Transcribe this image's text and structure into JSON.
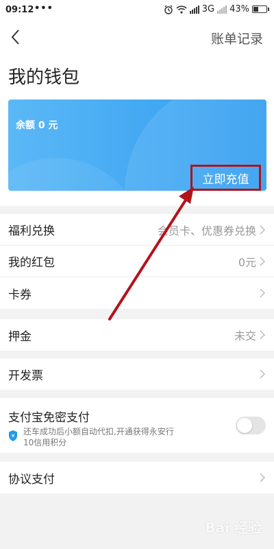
{
  "status_bar": {
    "time": "09:12",
    "dots": "•••",
    "network": "3G",
    "battery_text": "43%",
    "battery_level": 0.43
  },
  "nav": {
    "bill_link": "账单记录"
  },
  "page": {
    "title": "我的钱包"
  },
  "wallet_card": {
    "balance": "余额 0 元",
    "recharge_label": "立即充值"
  },
  "menu": {
    "welfare": {
      "label": "福利兑换",
      "value": "会员卡、优惠券兑换"
    },
    "red_packet": {
      "label": "我的红包",
      "value": "0元"
    },
    "coupons": {
      "label": "卡券"
    },
    "deposit": {
      "label": "押金",
      "value": "未交"
    },
    "invoice": {
      "label": "开发票"
    },
    "alipay": {
      "label": "支付宝免密支付",
      "desc": "还车成功后小额自动代扣,开通获得永安行10信用积分",
      "enabled": false
    },
    "agreement": {
      "label": "协议支付"
    }
  },
  "watermark": "Bai 经验",
  "colors": {
    "card_start": "#5bb8f6",
    "card_end": "#2f9cf0",
    "highlight": "#b3121b",
    "arrow": "#b3121b"
  }
}
